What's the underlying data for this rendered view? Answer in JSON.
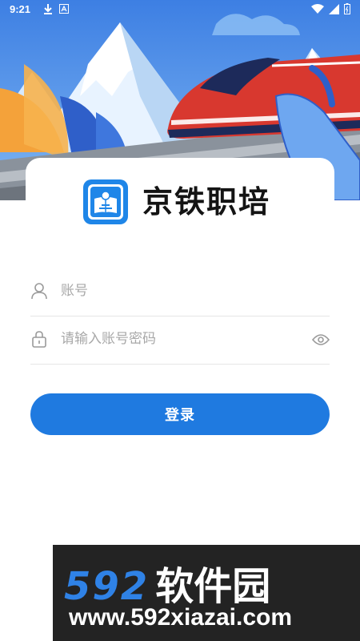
{
  "status_bar": {
    "time": "9:21",
    "left_icons": [
      "download-icon",
      "text-a-icon"
    ],
    "right_icons": [
      "wifi-icon",
      "signal-icon",
      "battery-icon"
    ]
  },
  "app": {
    "title": "京铁职培",
    "logo_icon": "railway-book-logo-icon",
    "accent_color": "#1f7ae0"
  },
  "login": {
    "account_placeholder": "账号",
    "password_placeholder": "请输入账号密码",
    "account_icon": "user-icon",
    "password_icon": "lock-icon",
    "visibility_icon": "eye-icon",
    "submit_label": "登录"
  },
  "watermark": {
    "brand_number": "592",
    "brand_text": "软件园",
    "url": "www.592xiazai.com"
  }
}
